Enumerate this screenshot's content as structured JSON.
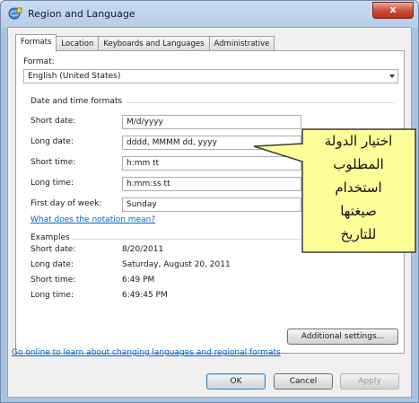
{
  "window": {
    "title": "Region and Language",
    "close_glyph": "x"
  },
  "tabs": [
    "Formats",
    "Location",
    "Keyboards and Languages",
    "Administrative"
  ],
  "format": {
    "label": "Format:",
    "value": "English (United States)"
  },
  "date_time": {
    "heading": "Date and time formats",
    "rows": [
      {
        "label": "Short date:",
        "value": "M/d/yyyy"
      },
      {
        "label": "Long date:",
        "value": "dddd, MMMM dd, yyyy"
      },
      {
        "label": "Short time:",
        "value": "h:mm tt"
      },
      {
        "label": "Long time:",
        "value": "h:mm:ss tt"
      },
      {
        "label": "First day of week:",
        "value": "Sunday"
      }
    ],
    "notation_link": "What does the notation mean?"
  },
  "examples": {
    "heading": "Examples",
    "rows": [
      {
        "label": "Short date:",
        "value": "8/20/2011"
      },
      {
        "label": "Long date:",
        "value": "Saturday, August 20, 2011"
      },
      {
        "label": "Short time:",
        "value": "6:49 PM"
      },
      {
        "label": "Long time:",
        "value": "6:49:45 PM"
      }
    ]
  },
  "additional_settings": "Additional settings...",
  "online_link": "Go online to learn about changing languages and regional formats",
  "buttons": {
    "ok": "OK",
    "cancel": "Cancel",
    "apply": "Apply"
  },
  "callout": {
    "lines": [
      "اختيار الدولة",
      "المطلوب",
      "استخدام",
      "صيغتها",
      "للتاريخ"
    ],
    "fill": "#ffff99"
  }
}
